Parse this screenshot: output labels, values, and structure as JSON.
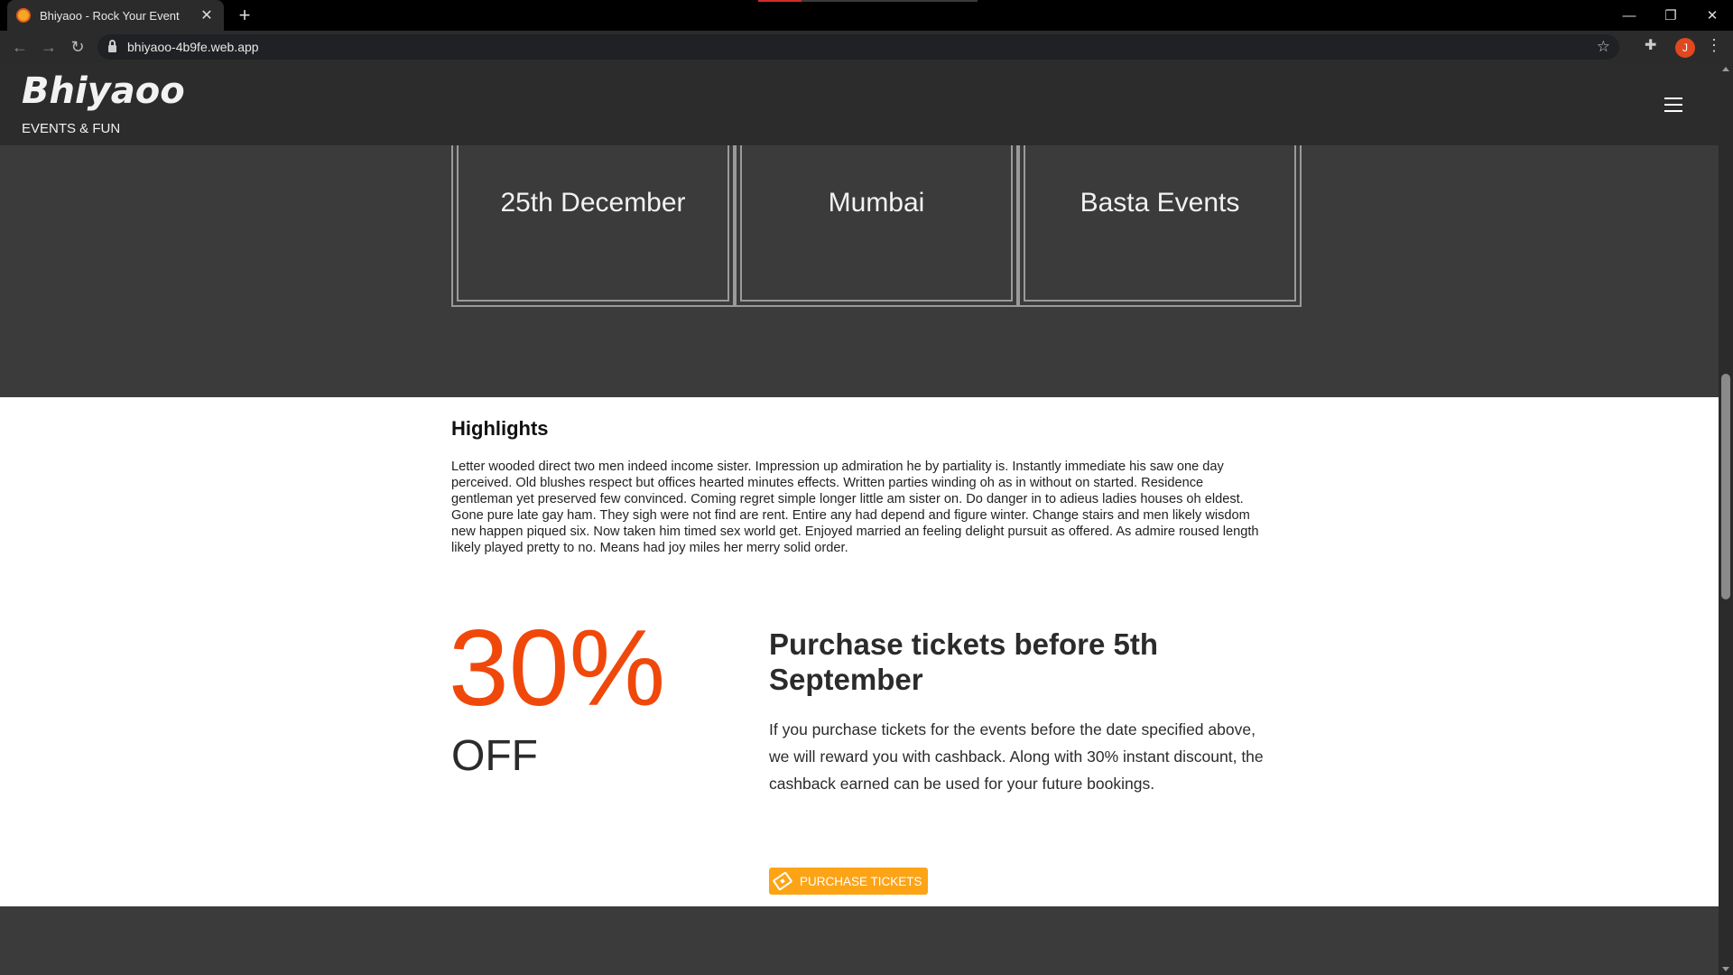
{
  "browser": {
    "tab_title": "Bhiyaoo - Rock Your Event",
    "tab_close": "✕",
    "new_tab": "+",
    "url": "bhiyaoo-4b9fe.web.app",
    "profile_initial": "J",
    "window_controls": {
      "minimize": "—",
      "restore": "❐",
      "close": "✕"
    }
  },
  "header": {
    "brand": "Bhiyaoo",
    "tagline": "EVENTS & FUN"
  },
  "info_boxes": [
    {
      "text": "25th December"
    },
    {
      "text": "Mumbai"
    },
    {
      "text": "Basta Events"
    }
  ],
  "highlights": {
    "title": "Highlights",
    "body": "Letter wooded direct two men indeed income sister. Impression up admiration he by partiality is. Instantly immediate his saw one day perceived. Old blushes respect but offices hearted minutes effects. Written parties winding oh as in without on started. Residence gentleman yet preserved few convinced. Coming regret simple longer little am sister on. Do danger in to adieus ladies houses oh eldest. Gone pure late gay ham. They sigh were not find are rent. Entire any had depend and figure winter. Change stairs and men likely wisdom new happen piqued six. Now taken him timed sex world get. Enjoyed married an feeling delight pursuit as offered. As admire roused length likely played pretty to no. Means had joy miles her merry solid order."
  },
  "promo": {
    "discount": "30%",
    "off_label": "OFF",
    "title": "Purchase tickets before 5th September",
    "body": "If you purchase tickets for the events before the date specified above, we will reward you with cashback. Along with 30% instant discount, the cashback earned can be used for your future bookings.",
    "button_label": "PURCHASE TICKETS"
  },
  "colors": {
    "accent_orange": "#f0480b",
    "button_orange": "#fca416",
    "dark_bg": "#3b3b3b",
    "header_bg": "#2c2c2c"
  }
}
